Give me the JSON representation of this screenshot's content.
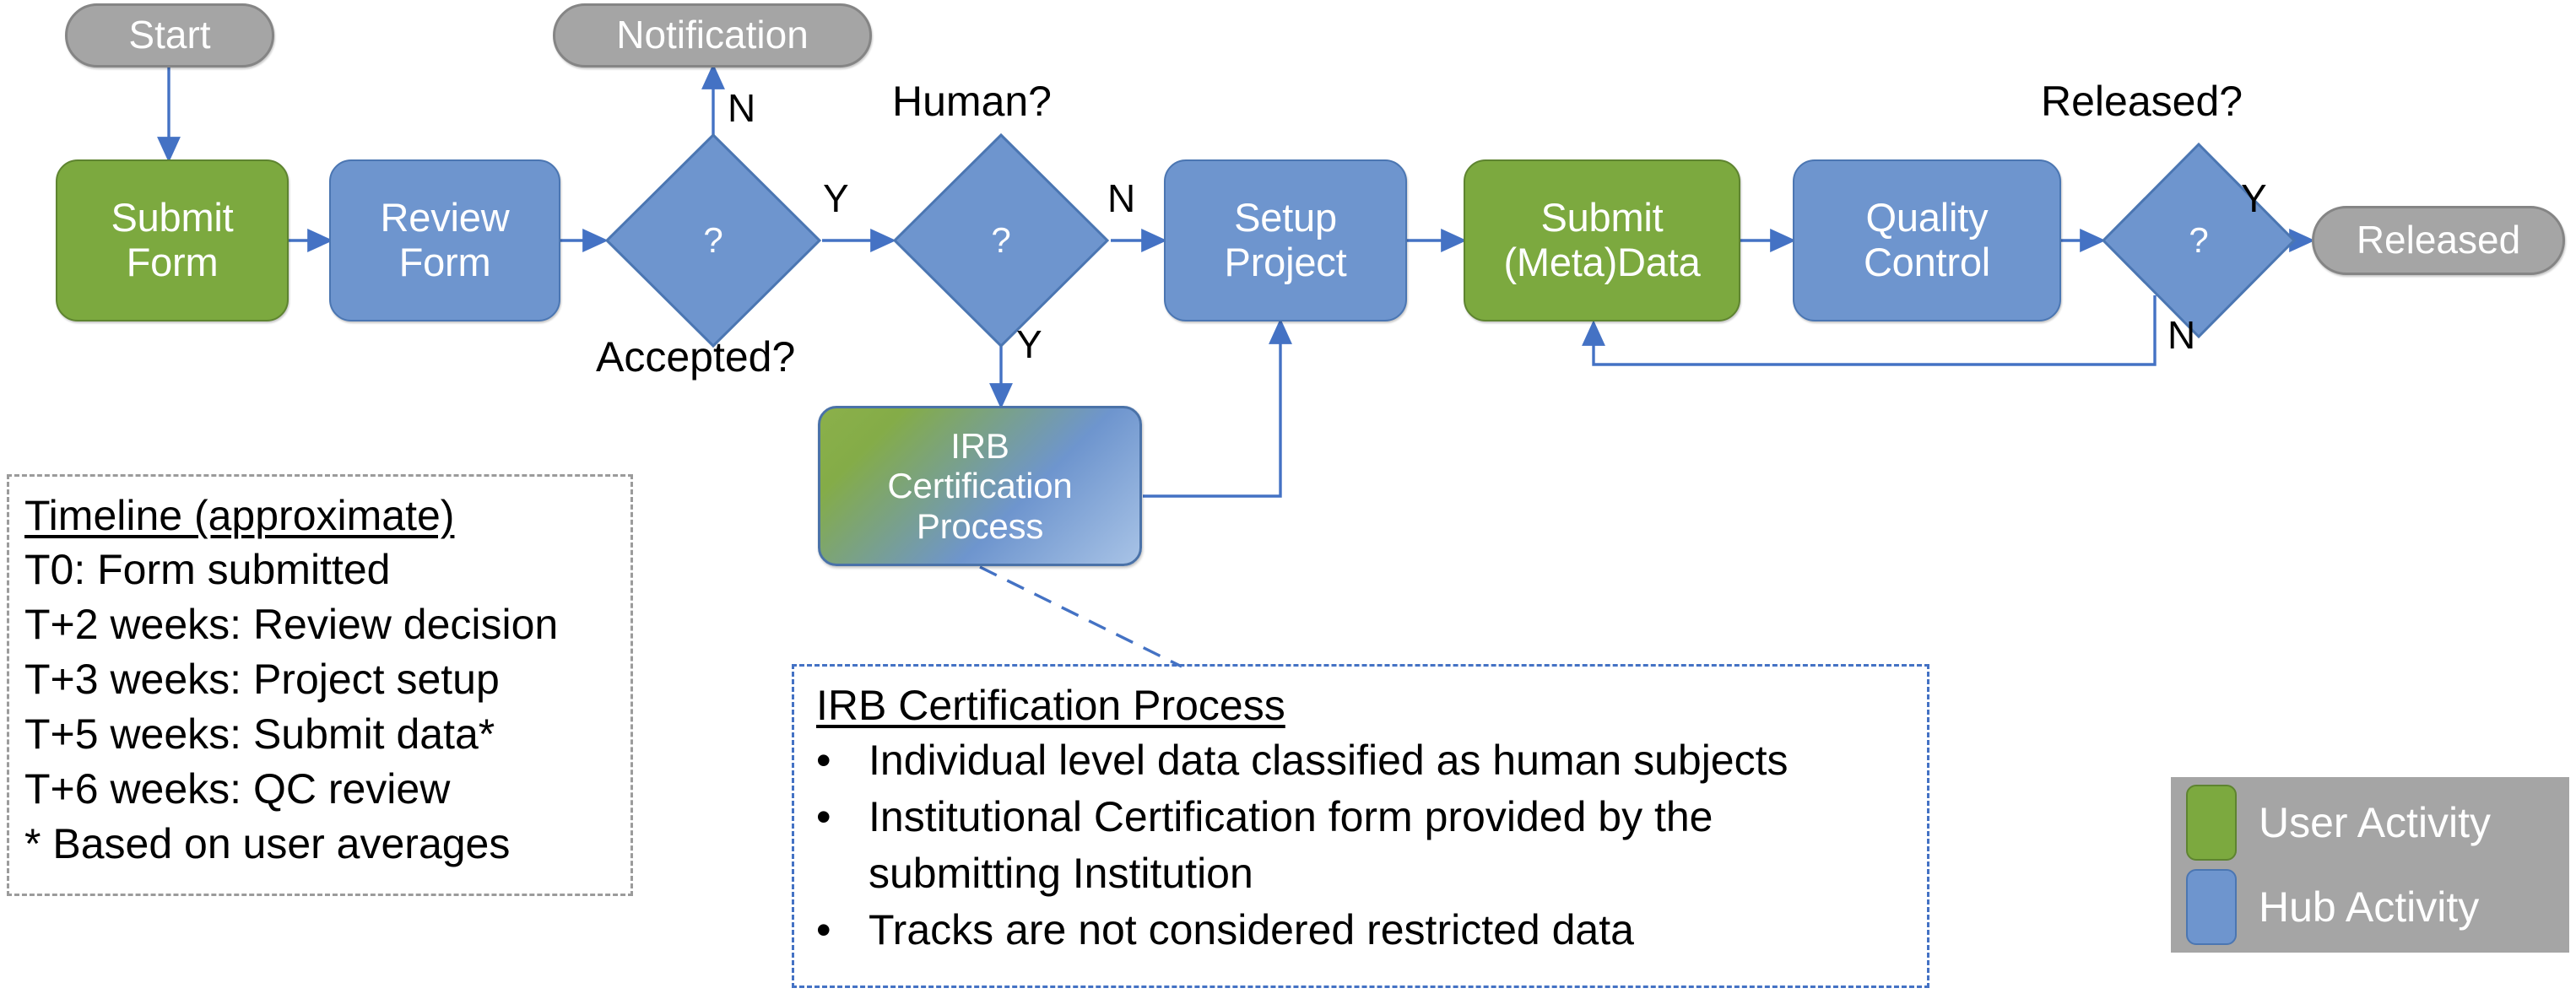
{
  "diagram": {
    "title": "Data submission and release workflow",
    "colors": {
      "user_activity": "#7CA93F",
      "hub_activity": "#6E95CE",
      "terminal": "#A5A5A5",
      "connector": "#4472C4",
      "callout_border": "#4472C4",
      "timeline_border": "#9B9B9B"
    }
  },
  "nodes": {
    "start": "Start",
    "submit_form": "Submit\nForm",
    "review_form": "Review\nForm",
    "accepted_decision": "?",
    "notification": "Notification",
    "human_decision": "?",
    "irb": "IRB\nCertification\nProcess",
    "setup_project": "Setup\nProject",
    "submit_metadata": "Submit\n(Meta)Data",
    "quality_control": "Quality\nControl",
    "released_decision": "?",
    "released": "Released"
  },
  "captions": {
    "accepted": "Accepted?",
    "human": "Human?",
    "released": "Released?"
  },
  "edge_labels": {
    "accepted_no": "N",
    "accepted_yes": "Y",
    "human_no": "N",
    "human_yes": "Y",
    "released_yes": "Y",
    "released_no": "N"
  },
  "timeline": {
    "title": "Timeline (approximate)",
    "lines": [
      "T0: Form submitted",
      "T+2 weeks: Review decision",
      "T+3 weeks: Project setup",
      "T+5 weeks: Submit data*",
      "T+6 weeks: QC review",
      "* Based on user averages"
    ]
  },
  "callout": {
    "title": "IRB Certification Process",
    "bullet": "•",
    "bullets": [
      "Individual level data classified as human subjects",
      "Institutional Certification form provided by the submitting Institution",
      "Tracks are not considered restricted data"
    ]
  },
  "legend": {
    "items": [
      {
        "label": "User Activity",
        "swatch": "user"
      },
      {
        "label": "Hub Activity",
        "swatch": "hub"
      }
    ]
  }
}
